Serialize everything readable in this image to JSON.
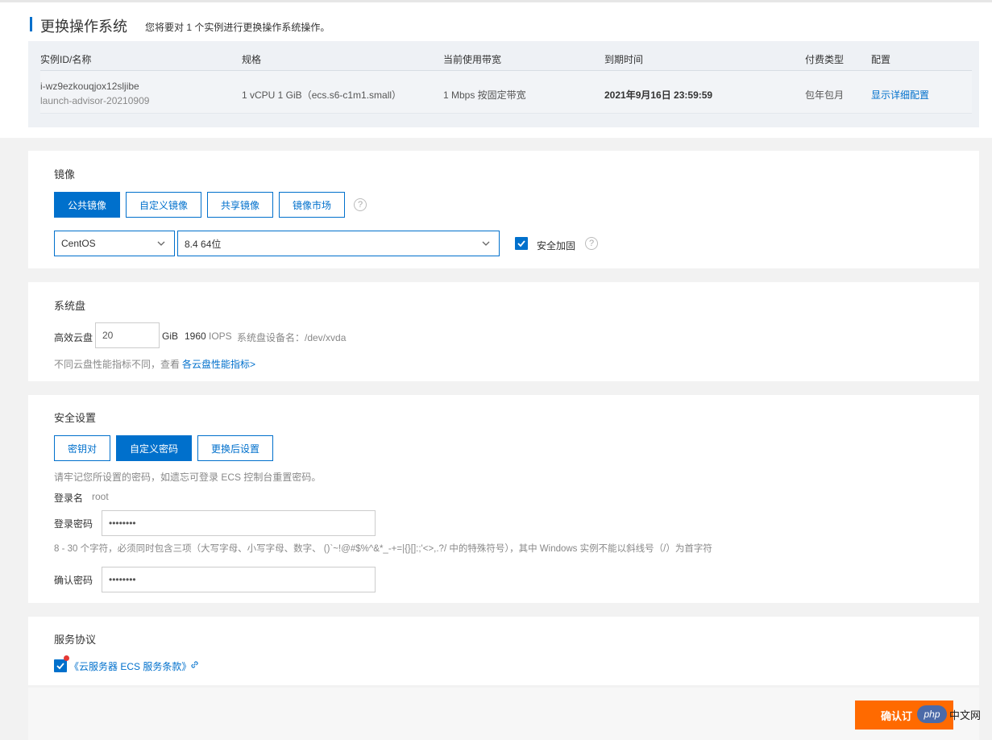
{
  "header": {
    "title": "更换操作系统",
    "subtitle": "您将要对 1 个实例进行更换操作系统操作。"
  },
  "instance_table": {
    "columns": [
      "实例ID/名称",
      "规格",
      "当前使用带宽",
      "到期时间",
      "付费类型",
      "配置"
    ],
    "row": {
      "id": "i-wz9ezkouqjox12sljibe",
      "name": "launch-advisor-20210909",
      "spec": "1 vCPU 1 GiB（ecs.s6-c1m1.small）",
      "bandwidth": "1 Mbps 按固定带宽",
      "expire": "2021年9月16日 23:59:59",
      "billing": "包年包月",
      "config_link": "显示详细配置"
    }
  },
  "image": {
    "title": "镜像",
    "tabs": [
      "公共镜像",
      "自定义镜像",
      "共享镜像",
      "镜像市场"
    ],
    "active_tab": "公共镜像",
    "os": "CentOS",
    "version": "8.4 64位",
    "security_label": "安全加固",
    "security_checked": true
  },
  "system_disk": {
    "title": "系统盘",
    "type_label": "高效云盘",
    "size": "20",
    "unit": "GiB",
    "iops_value": "1960",
    "iops_label": "IOPS",
    "device_label": "系统盘设备名：/dev/xvda",
    "note": "不同云盘性能指标不同，查看",
    "note_link": "各云盘性能指标>"
  },
  "security": {
    "title": "安全设置",
    "tabs": [
      "密钥对",
      "自定义密码",
      "更换后设置"
    ],
    "active_tab": "自定义密码",
    "reminder": "请牢记您所设置的密码，如遗忘可登录 ECS 控制台重置密码。",
    "login_name_label": "登录名",
    "login_name_value": "root",
    "password_label": "登录密码",
    "password_value": "••••••••",
    "password_rule": "8 - 30 个字符，必须同时包含三项（大写字母、小写字母、数字、 ()`~!@#$%^&*_-+=|{}[]:;'<>,.?/ 中的特殊符号），其中 Windows 实例不能以斜线号（/）为首字符",
    "confirm_label": "确认密码",
    "confirm_value": "••••••••"
  },
  "agreement": {
    "title": "服务协议",
    "link": "《云服务器 ECS 服务条款》",
    "checked": true
  },
  "footer": {
    "confirm_button": "确认订",
    "watermark_logo": "php",
    "watermark_text": "中文网"
  },
  "colors": {
    "primary": "#0070cc",
    "confirm": "#ff6a00",
    "background": "#f2f2f2"
  }
}
